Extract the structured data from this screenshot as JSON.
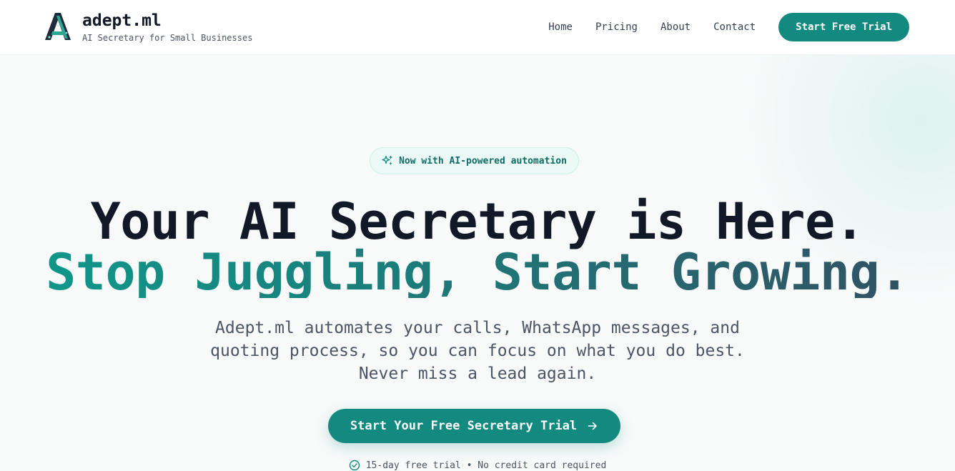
{
  "header": {
    "brand_name": "adept.ml",
    "brand_tagline": "AI Secretary for Small Businesses",
    "logo_icon": "adept-logo-icon",
    "nav": [
      {
        "label": "Home"
      },
      {
        "label": "Pricing"
      },
      {
        "label": "About"
      },
      {
        "label": "Contact"
      }
    ],
    "cta_label": "Start Free Trial"
  },
  "hero": {
    "badge_icon": "sparkles-icon",
    "badge_text": "Now with AI-powered automation",
    "headline_line1": "Your AI Secretary is Here.",
    "headline_line2": "Stop Juggling, Start Growing.",
    "subtitle": "Adept.ml automates your calls, WhatsApp messages, and quoting process, so you can focus on what you do best. Never miss a lead again.",
    "cta_label": "Start Your Free Secretary Trial",
    "cta_icon": "arrow-right-icon",
    "trial_note_icon": "check-circle-icon",
    "trial_note": "15-day free trial • No credit card required"
  },
  "colors": {
    "accent": "#138a80",
    "heading": "#111827",
    "body_text": "#4b5563",
    "badge_bg": "#ecfaf7"
  }
}
